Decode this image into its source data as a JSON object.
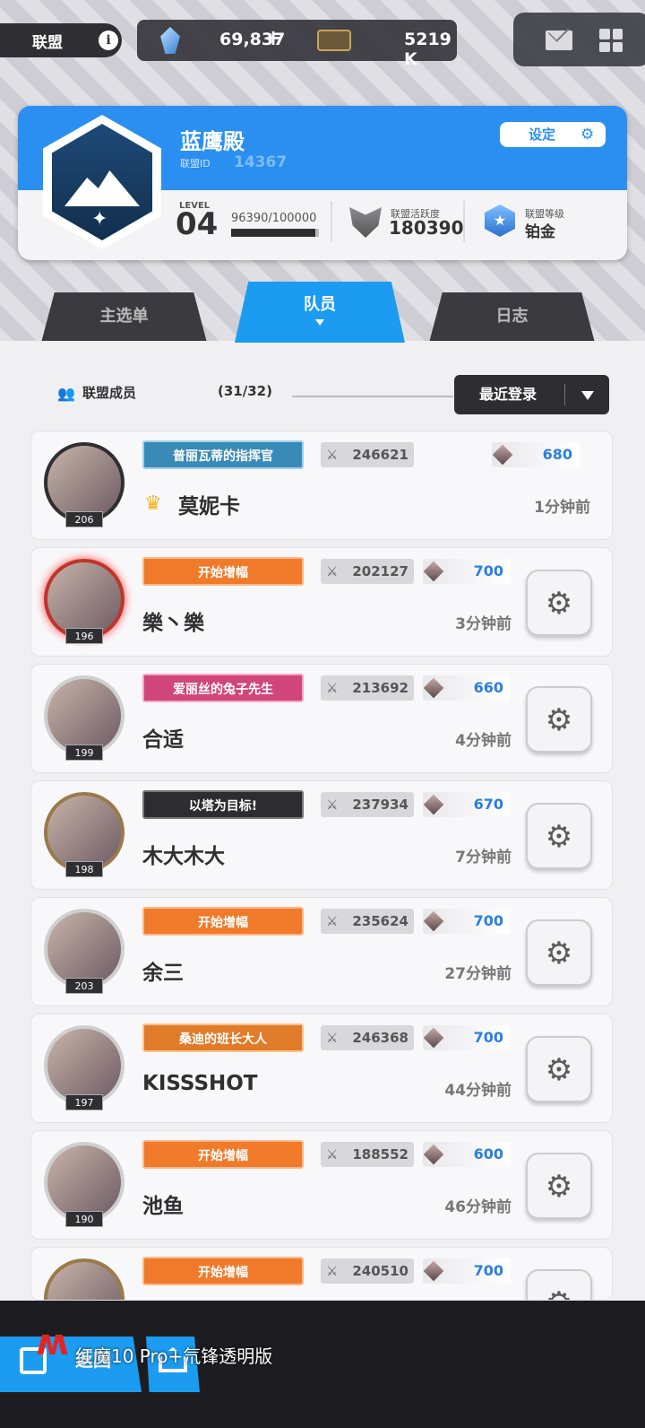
{
  "topbar": {
    "alliance_label": "联盟",
    "info": "i",
    "gems": "69,837",
    "plus": "+",
    "tickets": "5219 K"
  },
  "alliance": {
    "name": "蓝鹰殿",
    "id_label": "联盟ID",
    "id": "14367",
    "settings_label": "设定",
    "level_label": "LEVEL",
    "level": "04",
    "exp_text": "96390/100000",
    "exp_fraction": 0.9639,
    "activity_label": "联盟活跃度",
    "activity": "180390",
    "rank_label": "联盟等级",
    "rank": "铂金"
  },
  "tabs": [
    {
      "label": "主选单"
    },
    {
      "label": "队员"
    },
    {
      "label": "日志"
    }
  ],
  "list_header": {
    "members_label": "联盟成员",
    "count": "(31/32)",
    "sort_label": "最近登录"
  },
  "members": [
    {
      "level": "206",
      "title": "普丽瓦蒂的指挥官",
      "power": "246621",
      "contrib": "680",
      "name": "莫妮卡",
      "time": "1分钟前"
    },
    {
      "level": "196",
      "title": "开始增幅",
      "power": "202127",
      "contrib": "700",
      "name": "樂丶樂",
      "time": "3分钟前"
    },
    {
      "level": "199",
      "title": "爱丽丝的兔子先生",
      "power": "213692",
      "contrib": "660",
      "name": "合适",
      "time": "4分钟前"
    },
    {
      "level": "198",
      "title": "以塔为目标!",
      "power": "237934",
      "contrib": "670",
      "name": "木大木大",
      "time": "7分钟前"
    },
    {
      "level": "203",
      "title": "开始增幅",
      "power": "235624",
      "contrib": "700",
      "name": "余三",
      "time": "27分钟前"
    },
    {
      "level": "197",
      "title": "桑迪的班长大人",
      "power": "246368",
      "contrib": "700",
      "name": "KISSSHOT",
      "time": "44分钟前"
    },
    {
      "level": "190",
      "title": "开始增幅",
      "power": "188552",
      "contrib": "600",
      "name": "池鱼",
      "time": "46分钟前"
    },
    {
      "level": "",
      "title": "开始增幅",
      "power": "240510",
      "contrib": "700",
      "name": "",
      "time": ""
    }
  ],
  "bottom": {
    "back_label": "返回",
    "watermark": "红魔10 Pro+氘锋透明版"
  },
  "colors": {
    "accent": "#1b9cf0",
    "orange_title": "#f07a2a",
    "dark": "#2d2d32"
  }
}
